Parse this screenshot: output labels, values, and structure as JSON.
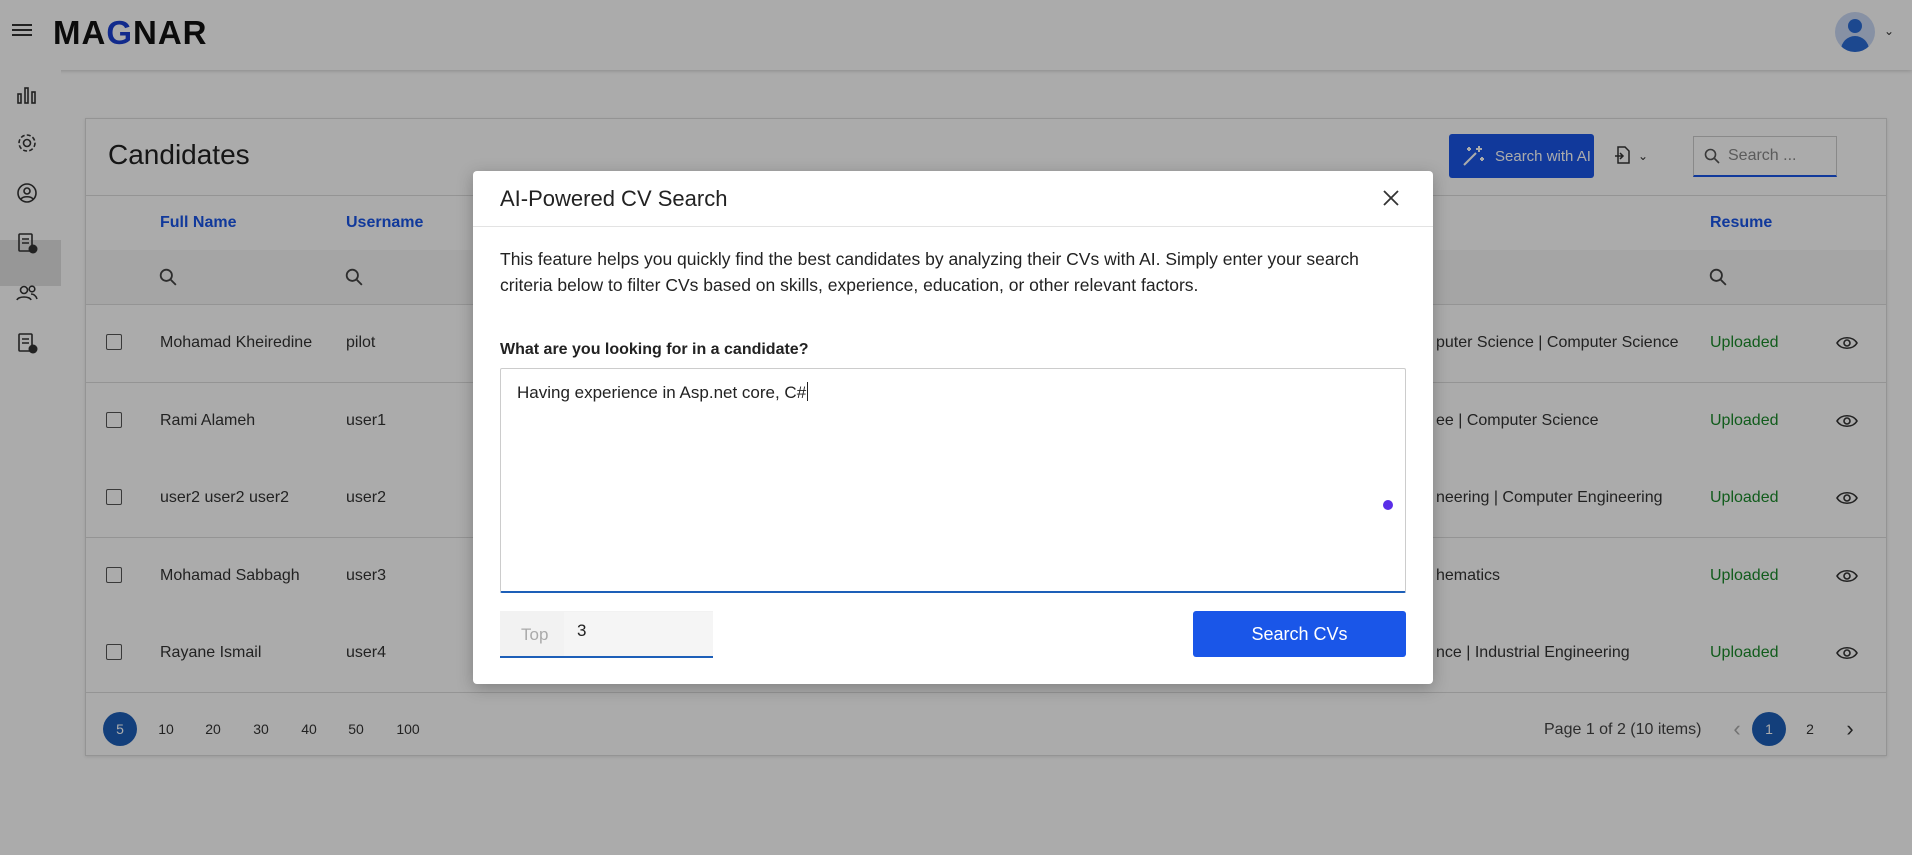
{
  "header": {
    "logo_pre": "MA",
    "logo_g": "G",
    "logo_post": "NAR"
  },
  "sidebar": {
    "items": [
      {
        "icon": "bar-chart-icon"
      },
      {
        "icon": "gear-icon"
      },
      {
        "icon": "user-circle-icon"
      },
      {
        "icon": "document-check-icon"
      },
      {
        "icon": "users-icon"
      },
      {
        "icon": "document-settings-icon"
      }
    ]
  },
  "candidates": {
    "title": "Candidates",
    "search_ai_label": "Search with AI",
    "search_placeholder": "Search ...",
    "columns": {
      "full_name": "Full Name",
      "username": "Username",
      "resume": "Resume"
    },
    "rows": [
      {
        "full_name": "Mohamad Kheiredine",
        "username": "pilot",
        "education": "puter Science | Computer Science",
        "resume": "Uploaded"
      },
      {
        "full_name": "Rami Alameh",
        "username": "user1",
        "education": "ee | Computer Science",
        "resume": "Uploaded"
      },
      {
        "full_name": "user2 user2 user2",
        "username": "user2",
        "education": "neering | Computer Engineering",
        "resume": "Uploaded"
      },
      {
        "full_name": "Mohamad Sabbagh",
        "username": "user3",
        "education": "hematics",
        "resume": "Uploaded"
      },
      {
        "full_name": "Rayane Ismail",
        "username": "user4",
        "education": "nce | Industrial Engineering",
        "resume": "Uploaded"
      }
    ],
    "page_sizes": [
      "5",
      "10",
      "20",
      "30",
      "40",
      "50",
      "100"
    ],
    "page_info": "Page 1 of 2 (10 items)",
    "pages": [
      "1",
      "2"
    ],
    "prev": "‹",
    "next": "›"
  },
  "modal": {
    "title": "AI-Powered CV Search",
    "description": "This feature helps you quickly find the best candidates by analyzing their CVs with AI. Simply enter your search criteria below to filter CVs based on skills, experience, education, or other relevant factors.",
    "prompt_label": "What are you looking for in a candidate?",
    "prompt_value": "Having experience in Asp.net core, C#",
    "top_label": "Top",
    "top_value": "3",
    "search_button": "Search CVs"
  },
  "colors": {
    "accent": "#1a56e8",
    "resume_uploaded": "#1a8a2a",
    "page_active": "#1d5fb8"
  }
}
